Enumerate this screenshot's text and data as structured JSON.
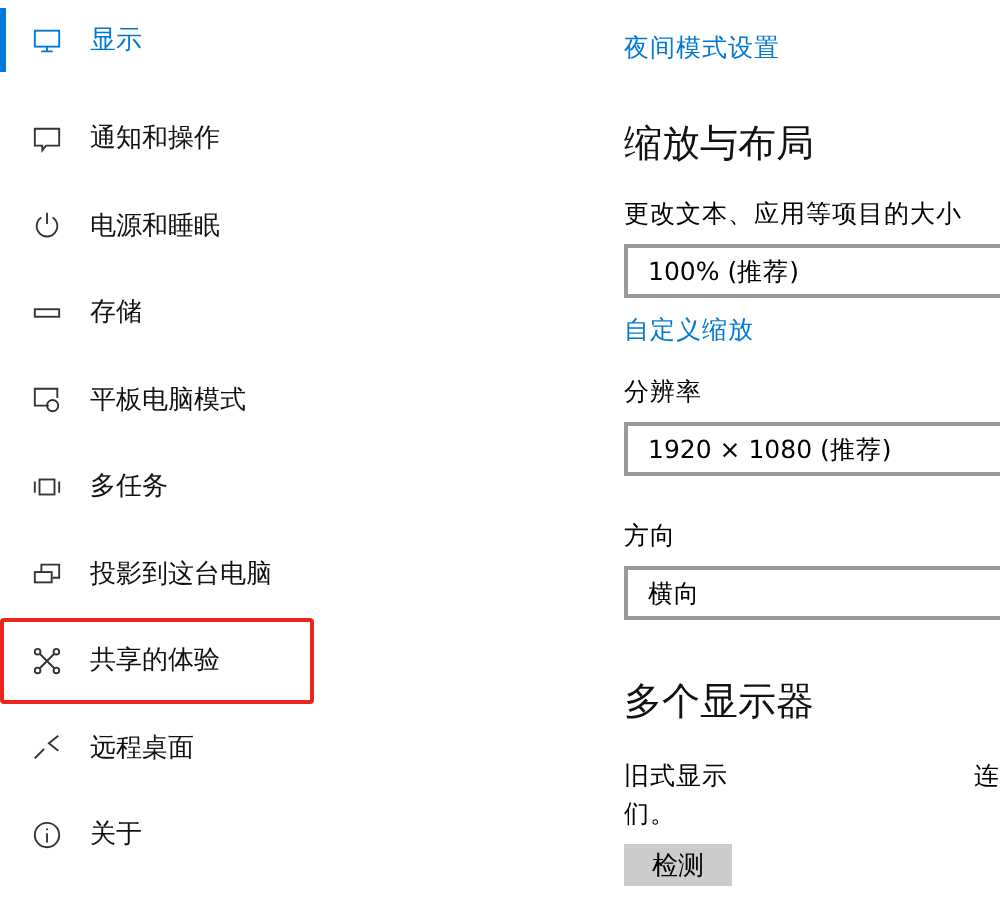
{
  "sidebar": {
    "items": [
      {
        "label": "显示",
        "kind": "monitor",
        "selected": true,
        "highlighted": false
      },
      {
        "label": "通知和操作",
        "kind": "message",
        "selected": false,
        "highlighted": false
      },
      {
        "label": "电源和睡眠",
        "kind": "power",
        "selected": false,
        "highlighted": false
      },
      {
        "label": "存储",
        "kind": "storage",
        "selected": false,
        "highlighted": false
      },
      {
        "label": "平板电脑模式",
        "kind": "tablet",
        "selected": false,
        "highlighted": false
      },
      {
        "label": "多任务",
        "kind": "multitask",
        "selected": false,
        "highlighted": false
      },
      {
        "label": "投影到这台电脑",
        "kind": "project",
        "selected": false,
        "highlighted": false
      },
      {
        "label": "共享的体验",
        "kind": "share",
        "selected": false,
        "highlighted": true
      },
      {
        "label": "远程桌面",
        "kind": "remote",
        "selected": false,
        "highlighted": false
      },
      {
        "label": "关于",
        "kind": "info",
        "selected": false,
        "highlighted": false
      }
    ]
  },
  "content": {
    "night_link": "夜间模式设置",
    "scale_heading": "缩放与布局",
    "scale_label": "更改文本、应用等项目的大小",
    "scale_value": "100% (推荐)",
    "custom_link": "自定义缩放",
    "resolution_label": "分辨率",
    "resolution_value": "1920 × 1080 (推荐)",
    "orientation_label": "方向",
    "orientation_value": "横向",
    "multi_heading": "多个显示器",
    "desc_start": "旧式显示",
    "desc_end": "连",
    "desc_line2": "们。",
    "detect_button": "检测"
  }
}
